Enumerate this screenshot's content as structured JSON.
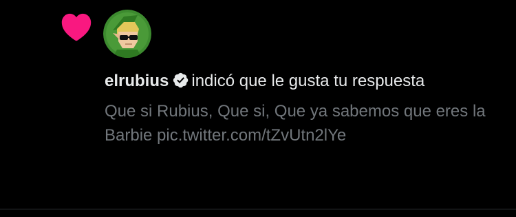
{
  "notification": {
    "username": "elrubius",
    "action_text": "indicó que le gusta tu respuesta",
    "tweet_text": "Que si Rubius, Que si, Que ya sabemos que eres la Barbie pic.twitter.com/tZvUtn2lYe",
    "icon": "heart-icon",
    "verified_icon": "verified-badge-icon",
    "colors": {
      "heart": "#f91880",
      "text": "#e7e9ea",
      "secondary_text": "#71767b",
      "background": "#000000",
      "divider": "#2f3336"
    }
  }
}
